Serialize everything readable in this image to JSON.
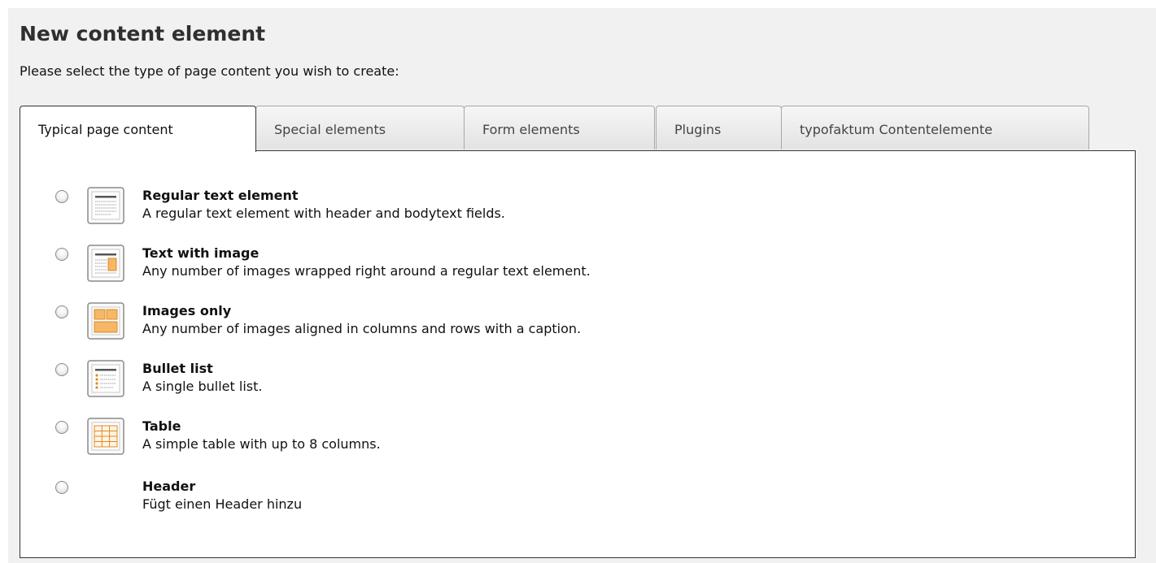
{
  "header": {
    "title": "New content element",
    "instruction": "Please select the type of page content you wish to create:"
  },
  "tabs": [
    {
      "label": "Typical page content",
      "active": true
    },
    {
      "label": "Special elements",
      "active": false
    },
    {
      "label": "Form elements",
      "active": false
    },
    {
      "label": "Plugins",
      "active": false
    },
    {
      "label": "typofaktum Contentelemente",
      "active": false
    }
  ],
  "options": [
    {
      "title": "Regular text element",
      "description": "A regular text element with header and bodytext fields.",
      "icon": "text-element-icon"
    },
    {
      "title": "Text with image",
      "description": "Any number of images wrapped right around a regular text element.",
      "icon": "text-with-image-icon"
    },
    {
      "title": "Images only",
      "description": "Any number of images aligned in columns and rows with a caption.",
      "icon": "images-only-icon"
    },
    {
      "title": "Bullet list",
      "description": "A single bullet list.",
      "icon": "bullet-list-icon"
    },
    {
      "title": "Table",
      "description": "A simple table with up to 8 columns.",
      "icon": "table-icon"
    },
    {
      "title": "Header",
      "description": "Fügt einen Header hinzu",
      "icon": ""
    }
  ],
  "colors": {
    "icon_accent": "#f0a040",
    "border": "#333333",
    "tab_inactive_bg": "#e8e8e8"
  }
}
